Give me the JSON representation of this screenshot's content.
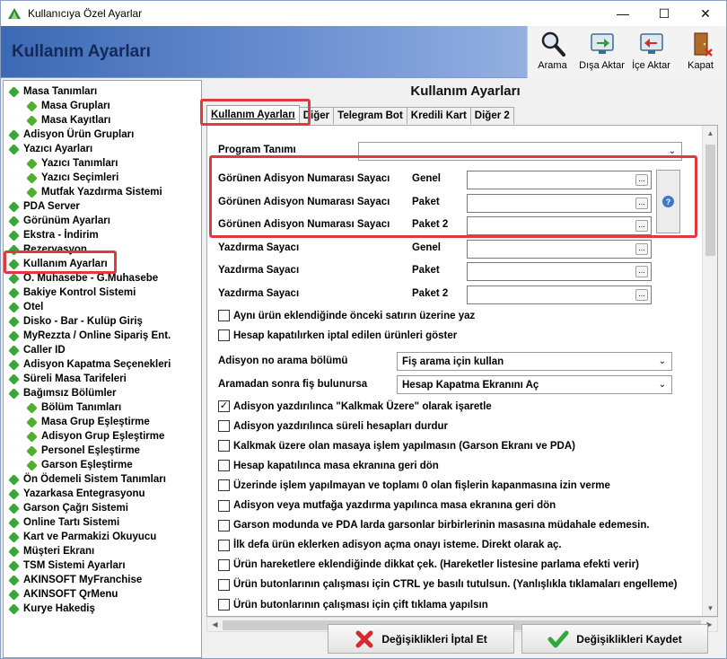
{
  "window": {
    "title": "Kullanıcıya Özel Ayarlar",
    "minimize": "—",
    "maximize": "☐",
    "close": "✕"
  },
  "header": {
    "title": "Kullanım Ayarları"
  },
  "toolbar": {
    "search": "Arama",
    "export": "Dışa Aktar",
    "import": "İçe Aktar",
    "close": "Kapat"
  },
  "tree": [
    {
      "label": "Masa Tanımları",
      "level": 0
    },
    {
      "label": "Masa Grupları",
      "level": 1
    },
    {
      "label": "Masa Kayıtları",
      "level": 1
    },
    {
      "label": "Adisyon Ürün Grupları",
      "level": 0
    },
    {
      "label": "Yazıcı Ayarları",
      "level": 0
    },
    {
      "label": "Yazıcı Tanımları",
      "level": 1
    },
    {
      "label": "Yazıcı Seçimleri",
      "level": 1
    },
    {
      "label": "Mutfak Yazdırma Sistemi",
      "level": 1
    },
    {
      "label": "PDA Server",
      "level": 0
    },
    {
      "label": "Görünüm Ayarları",
      "level": 0
    },
    {
      "label": "Ekstra - İndirim",
      "level": 0
    },
    {
      "label": "Rezervasyon",
      "level": 0
    },
    {
      "label": "Kullanım Ayarları",
      "level": 0
    },
    {
      "label": "Ö. Muhasebe - G.Muhasebe",
      "level": 0
    },
    {
      "label": "Bakiye Kontrol Sistemi",
      "level": 0
    },
    {
      "label": "Otel",
      "level": 0
    },
    {
      "label": "Disko - Bar - Kulüp Giriş",
      "level": 0
    },
    {
      "label": "MyRezzta / Online Sipariş Ent.",
      "level": 0
    },
    {
      "label": "Caller ID",
      "level": 0
    },
    {
      "label": "Adisyon Kapatma Seçenekleri",
      "level": 0
    },
    {
      "label": "Süreli Masa Tarifeleri",
      "level": 0
    },
    {
      "label": "Bağımsız Bölümler",
      "level": 0
    },
    {
      "label": "Bölüm Tanımları",
      "level": 1
    },
    {
      "label": "Masa Grup Eşleştirme",
      "level": 1
    },
    {
      "label": "Adisyon Grup Eşleştirme",
      "level": 1
    },
    {
      "label": "Personel Eşleştirme",
      "level": 1
    },
    {
      "label": "Garson Eşleştirme",
      "level": 1
    },
    {
      "label": "Ön Ödemeli Sistem Tanımları",
      "level": 0
    },
    {
      "label": "Yazarkasa Entegrasyonu",
      "level": 0
    },
    {
      "label": "Garson Çağrı Sistemi",
      "level": 0
    },
    {
      "label": "Online Tartı Sistemi",
      "level": 0
    },
    {
      "label": "Kart ve Parmakizi Okuyucu",
      "level": 0
    },
    {
      "label": "Müşteri Ekranı",
      "level": 0
    },
    {
      "label": "TSM Sistemi Ayarları",
      "level": 0
    },
    {
      "label": "AKINSOFT MyFranchise",
      "level": 0
    },
    {
      "label": "AKINSOFT QrMenu",
      "level": 0
    },
    {
      "label": "Kurye Hakediş",
      "level": 0
    }
  ],
  "right": {
    "title": "Kullanım Ayarları"
  },
  "tabs": [
    "Kullanım Ayarları",
    "Diğer",
    "Telegram Bot",
    "Kredili Kart",
    "Diğer 2"
  ],
  "form": {
    "program_label": "Program Tanımı",
    "program_value": "",
    "rows": [
      {
        "label": "Görünen Adisyon Numarası Sayacı",
        "type": "Genel",
        "value": ""
      },
      {
        "label": "Görünen Adisyon Numarası Sayacı",
        "type": "Paket",
        "value": ""
      },
      {
        "label": "Görünen Adisyon Numarası Sayacı",
        "type": "Paket 2",
        "value": ""
      },
      {
        "label": "Yazdırma Sayacı",
        "type": "Genel",
        "value": ""
      },
      {
        "label": "Yazdırma Sayacı",
        "type": "Paket",
        "value": ""
      },
      {
        "label": "Yazdırma Sayacı",
        "type": "Paket 2",
        "value": ""
      }
    ],
    "dots": "...",
    "help": "?",
    "cb1": {
      "label": "Aynı ürün eklendiğinde önceki satırın üzerine yaz",
      "checked": false
    },
    "cb2": {
      "label": "Hesap kapatılırken iptal edilen ürünleri göster",
      "checked": false
    },
    "search_label": "Adisyon no arama bölümü",
    "search_value": "Fiş arama için kullan",
    "after_label": "Aramadan sonra fiş bulunursa",
    "after_value": "Hesap Kapatma Ekranını Aç",
    "checks": [
      {
        "label": "Adisyon yazdırılınca \"Kalkmak Üzere\" olarak işaretle",
        "checked": true
      },
      {
        "label": "Adisyon yazdırılınca süreli hesapları durdur",
        "checked": false
      },
      {
        "label": "Kalkmak üzere olan masaya işlem yapılmasın (Garson Ekranı ve PDA)",
        "checked": false
      },
      {
        "label": "Hesap kapatılınca masa ekranına geri dön",
        "checked": false
      },
      {
        "label": "Üzerinde işlem yapılmayan ve toplamı 0 olan fişlerin kapanmasına izin verme",
        "checked": false
      },
      {
        "label": "Adisyon veya mutfağa yazdırma yapılınca masa ekranına geri dön",
        "checked": false
      },
      {
        "label": "Garson modunda ve PDA larda garsonlar birbirlerinin masasına müdahale edemesin.",
        "checked": false
      },
      {
        "label": "İlk defa ürün eklerken adisyon açma onayı isteme. Direkt olarak aç.",
        "checked": false
      },
      {
        "label": "Ürün hareketlere eklendiğinde dikkat çek. (Hareketler listesine parlama efekti verir)",
        "checked": false
      },
      {
        "label": "Ürün butonlarının çalışması için CTRL ye basılı tutulsun. (Yanlışlıkla tıklamaları engelleme)",
        "checked": false
      },
      {
        "label": "Ürün butonlarının çalışması için çift tıklama yapılsın",
        "checked": false
      }
    ],
    "check_mark": "✓"
  },
  "buttons": {
    "cancel": "Değişiklikleri İptal Et",
    "save": "Değişiklikleri Kaydet"
  },
  "colors": {
    "highlight": "#e0393e",
    "header_blue": "#3c69b4",
    "tree_icon": "#3aa53a"
  }
}
